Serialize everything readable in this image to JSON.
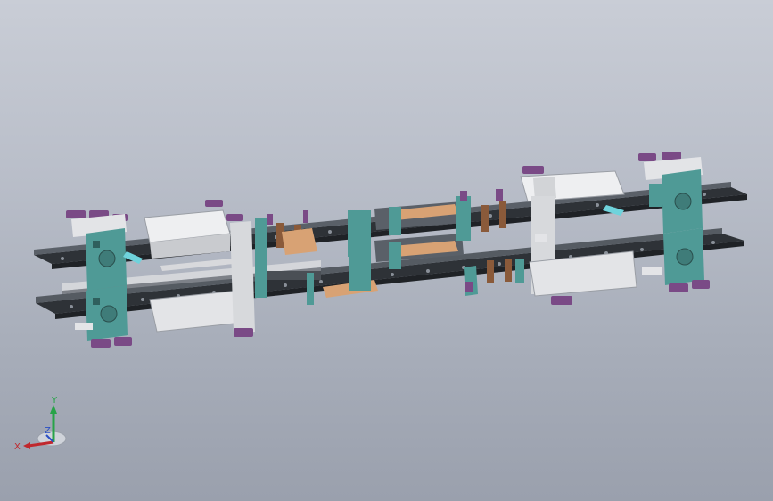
{
  "viewport": {
    "background_top": "#c9cdd6",
    "background_bottom": "#9aa0ad"
  },
  "model": {
    "frame_color": "#3a3f45",
    "conveyor_color": "#2e3237",
    "panel_color": "#4f9a96",
    "cover_color": "#e3e4e7",
    "pad_color": "#7a4a86",
    "accent_color": "#6fd3dc",
    "plate_color": "#d8a274"
  },
  "triad": {
    "x_label": "X",
    "y_label": "Y",
    "z_label": "Z",
    "x_color": "#c0282d",
    "y_color": "#27a348",
    "z_color": "#2b4fc4"
  }
}
